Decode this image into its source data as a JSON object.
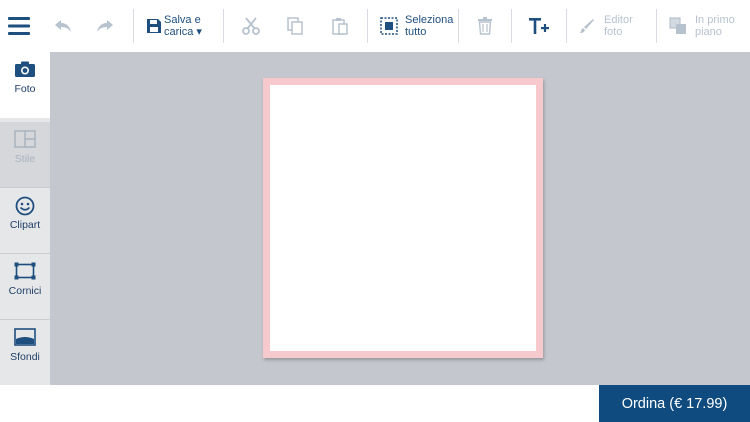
{
  "toolbar": {
    "save_label": "Salva e\ncarica ▾",
    "select_all_label": "Seleziona\ntutto",
    "photo_editor_label": "Editor\nfoto",
    "foreground_label": "In primo\npiano"
  },
  "sidebar": {
    "items": [
      {
        "label": "Foto",
        "icon": "camera-icon",
        "state": "active"
      },
      {
        "label": "Stile",
        "icon": "layout-icon",
        "state": "disabled"
      },
      {
        "label": "Clipart",
        "icon": "smiley-icon",
        "state": "normal"
      },
      {
        "label": "Cornici",
        "icon": "frame-icon",
        "state": "normal"
      },
      {
        "label": "Sfondi",
        "icon": "background-image-icon",
        "state": "normal"
      }
    ]
  },
  "order": {
    "label": "Ordina (€ 17.99)"
  },
  "colors": {
    "accent": "#0f4b7e",
    "icon_active": "#1f5a8c",
    "icon_disabled": "#b7c2cf",
    "workspace": "#c4c7cd",
    "page_border": "#f6c9cc"
  }
}
